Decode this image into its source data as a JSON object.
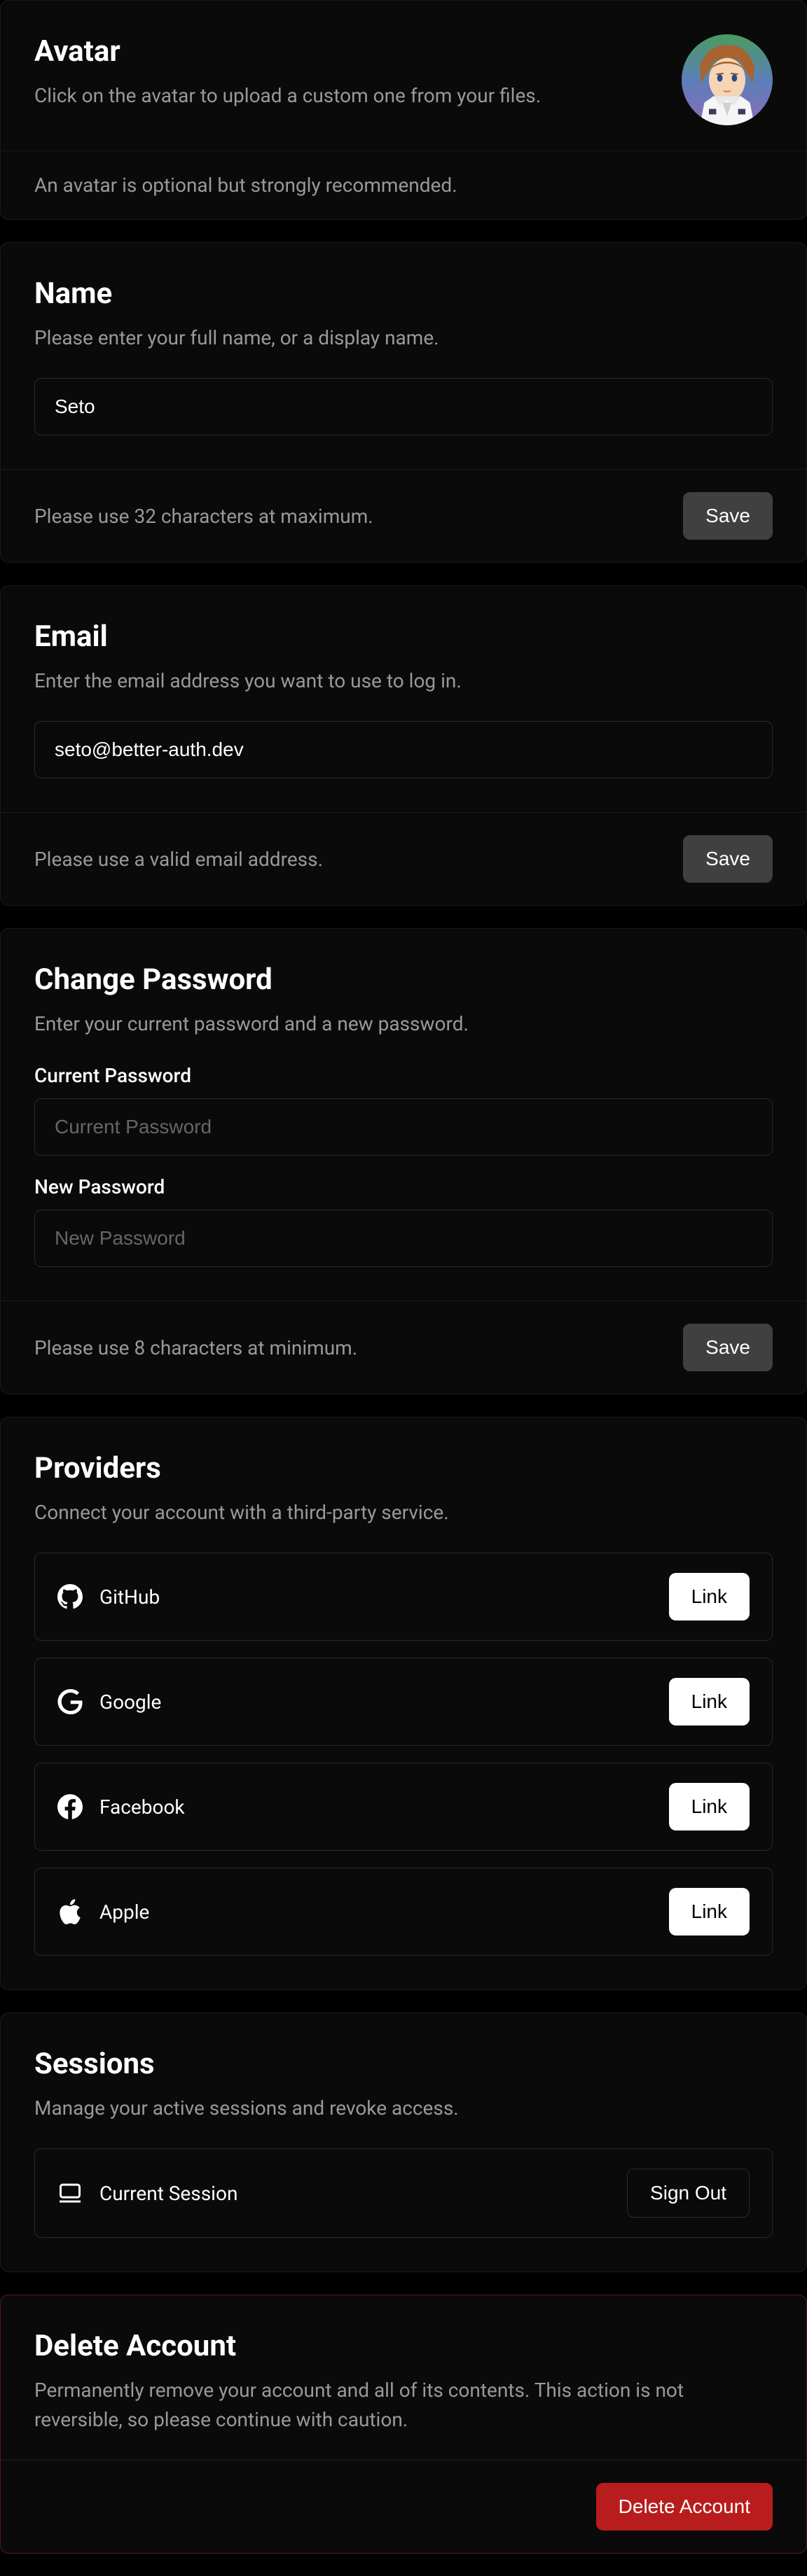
{
  "avatar": {
    "title": "Avatar",
    "desc": "Click on the avatar to upload a custom one from your files.",
    "footer": "An avatar is optional but strongly recommended."
  },
  "name": {
    "title": "Name",
    "desc": "Please enter your full name, or a display name.",
    "value": "Seto",
    "footer": "Please use 32 characters at maximum.",
    "save": "Save"
  },
  "email": {
    "title": "Email",
    "desc": "Enter the email address you want to use to log in.",
    "value": "seto@better-auth.dev",
    "footer": "Please use a valid email address.",
    "save": "Save"
  },
  "password": {
    "title": "Change Password",
    "desc": "Enter your current password and a new password.",
    "current_label": "Current Password",
    "current_placeholder": "Current Password",
    "new_label": "New Password",
    "new_placeholder": "New Password",
    "footer": "Please use 8 characters at minimum.",
    "save": "Save"
  },
  "providers": {
    "title": "Providers",
    "desc": "Connect your account with a third-party service.",
    "items": [
      {
        "name": "GitHub",
        "link": "Link"
      },
      {
        "name": "Google",
        "link": "Link"
      },
      {
        "name": "Facebook",
        "link": "Link"
      },
      {
        "name": "Apple",
        "link": "Link"
      }
    ]
  },
  "sessions": {
    "title": "Sessions",
    "desc": "Manage your active sessions and revoke access.",
    "current": "Current Session",
    "signout": "Sign Out"
  },
  "delete": {
    "title": "Delete Account",
    "desc": "Permanently remove your account and all of its contents. This action is not reversible, so please continue with caution.",
    "button": "Delete Account"
  }
}
